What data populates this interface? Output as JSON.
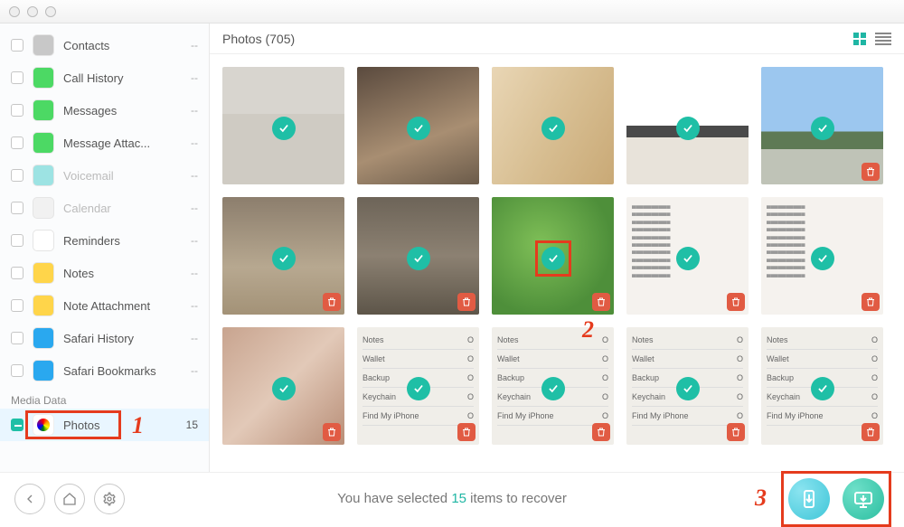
{
  "header": {
    "title": "Photos (705)"
  },
  "sidebar": {
    "categories": [
      {
        "label": "Contacts",
        "count": "--",
        "icon": "contacts",
        "color": "#c8c8c8"
      },
      {
        "label": "Call History",
        "count": "--",
        "icon": "phone",
        "color": "#4cd964"
      },
      {
        "label": "Messages",
        "count": "--",
        "icon": "msg",
        "color": "#4cd964"
      },
      {
        "label": "Message Attac...",
        "count": "--",
        "icon": "msg",
        "color": "#4cd964"
      },
      {
        "label": "Voicemail",
        "count": "--",
        "icon": "vm",
        "color": "#9de3e3",
        "dim": true
      },
      {
        "label": "Calendar",
        "count": "--",
        "icon": "cal",
        "color": "#f1f1f1",
        "dim": true
      },
      {
        "label": "Reminders",
        "count": "--",
        "icon": "rem",
        "color": "#ffffff"
      },
      {
        "label": "Notes",
        "count": "--",
        "icon": "notes",
        "color": "#ffd54a"
      },
      {
        "label": "Note Attachment",
        "count": "--",
        "icon": "noteatt",
        "color": "#ffd54a"
      },
      {
        "label": "Safari History",
        "count": "--",
        "icon": "safari",
        "color": "#2aa8ef"
      },
      {
        "label": "Safari Bookmarks",
        "count": "--",
        "icon": "safari",
        "color": "#2aa8ef"
      }
    ],
    "media_header": "Media Data",
    "photos": {
      "label": "Photos",
      "count": "15"
    }
  },
  "grid": {
    "items": [
      {
        "bg": "room",
        "trash": false
      },
      {
        "bg": "bedroom",
        "trash": false
      },
      {
        "bg": "food1",
        "trash": false
      },
      {
        "bg": "desk",
        "trash": false
      },
      {
        "bg": "building",
        "trash": true
      },
      {
        "bg": "kids",
        "trash": true
      },
      {
        "bg": "hall",
        "trash": true
      },
      {
        "bg": "veggies",
        "trash": true,
        "highlight": true
      },
      {
        "bg": "doc1",
        "trash": true
      },
      {
        "bg": "doc2",
        "trash": true
      },
      {
        "bg": "rolls",
        "trash": true
      },
      {
        "bg": "list",
        "trash": true
      },
      {
        "bg": "list",
        "trash": true
      },
      {
        "bg": "list",
        "trash": true
      },
      {
        "bg": "list2",
        "trash": true
      }
    ],
    "list_rows": [
      "Notes",
      "Wallet",
      "Backup",
      "Keychain",
      "Find My iPhone"
    ]
  },
  "footer": {
    "status_pre": "You have selected ",
    "status_num": "15",
    "status_post": " items to recover"
  },
  "annotations": {
    "a1": "1",
    "a2": "2",
    "a3": "3"
  }
}
